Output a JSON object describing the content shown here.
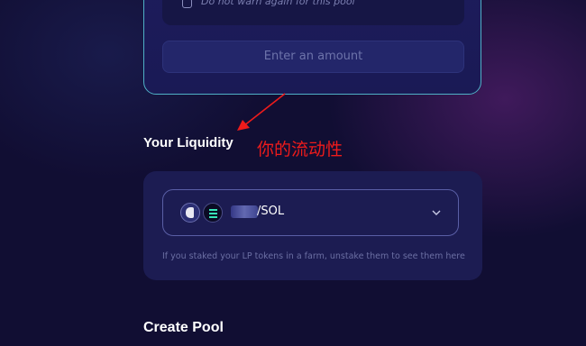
{
  "swap": {
    "warning_checkbox_label": "Do not warn again for this pool",
    "enter_amount_button": "Enter an amount"
  },
  "liquidity": {
    "title": "Your Liquidity",
    "annotation": "你的流动性",
    "pool": {
      "token_a_icon": "token-logo-icon",
      "token_b_icon": "solana-icon",
      "pair_label": "/SOL"
    },
    "hint": "If you staked your LP tokens in a farm, unstake them to see them here"
  },
  "create_pool": {
    "title": "Create Pool"
  },
  "colors": {
    "background": "#110e33",
    "card": "#1c1c52",
    "accent_border": "#4fb0c6",
    "annotation": "#ee1b1b"
  }
}
